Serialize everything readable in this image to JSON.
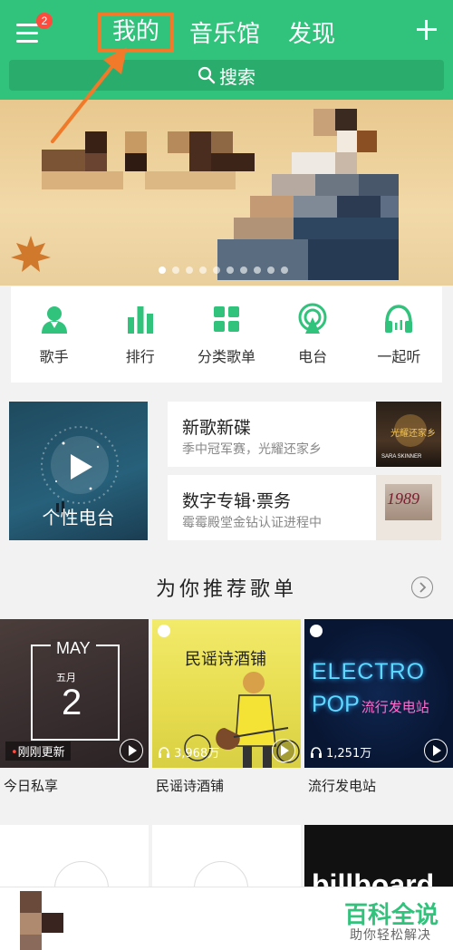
{
  "header": {
    "menu_badge": "2",
    "tabs": [
      {
        "label": "我的",
        "active": true
      },
      {
        "label": "音乐馆",
        "active": false
      },
      {
        "label": "发现",
        "active": false
      }
    ],
    "search_placeholder": "搜索",
    "accent_color": "#31c27c"
  },
  "banner": {
    "dots_total": 10,
    "active_dot": 1
  },
  "quick_nav": [
    {
      "label": "歌手",
      "icon": "singer-icon"
    },
    {
      "label": "排行",
      "icon": "chart-bars-icon"
    },
    {
      "label": "分类歌单",
      "icon": "grid-icon"
    },
    {
      "label": "电台",
      "icon": "radio-icon"
    },
    {
      "label": "一起听",
      "icon": "headphones-icon"
    }
  ],
  "features": {
    "personal_radio": "个性电台",
    "album_1": {
      "title": "新歌新碟",
      "subtitle": "季中冠军赛，光耀还家乡",
      "cover_text": "光耀还家乡",
      "cover_artist": "SARA SKINNER"
    },
    "album_2": {
      "title": "数字专辑·票务",
      "subtitle": "霉霉殿堂金钻认证进程中",
      "cover_text": "1989"
    }
  },
  "recommend": {
    "title": "为你推荐歌单",
    "playlists": [
      {
        "name": "今日私享",
        "month": "MAY",
        "month_cn": "五月",
        "day": "2",
        "tag": "刚刚更新"
      },
      {
        "name": "民谣诗酒铺",
        "cover_title": "民谣诗酒铺",
        "plays": "3,968万"
      },
      {
        "name": "流行发电站",
        "cover_line1": "ELECTRO",
        "cover_line2": "POP",
        "cover_suffix": "流行发电站",
        "plays": "1,251万"
      }
    ],
    "row2_cover_text": "billboard"
  },
  "watermark": {
    "title": "百科全说",
    "subtitle": "助你轻松解决"
  }
}
